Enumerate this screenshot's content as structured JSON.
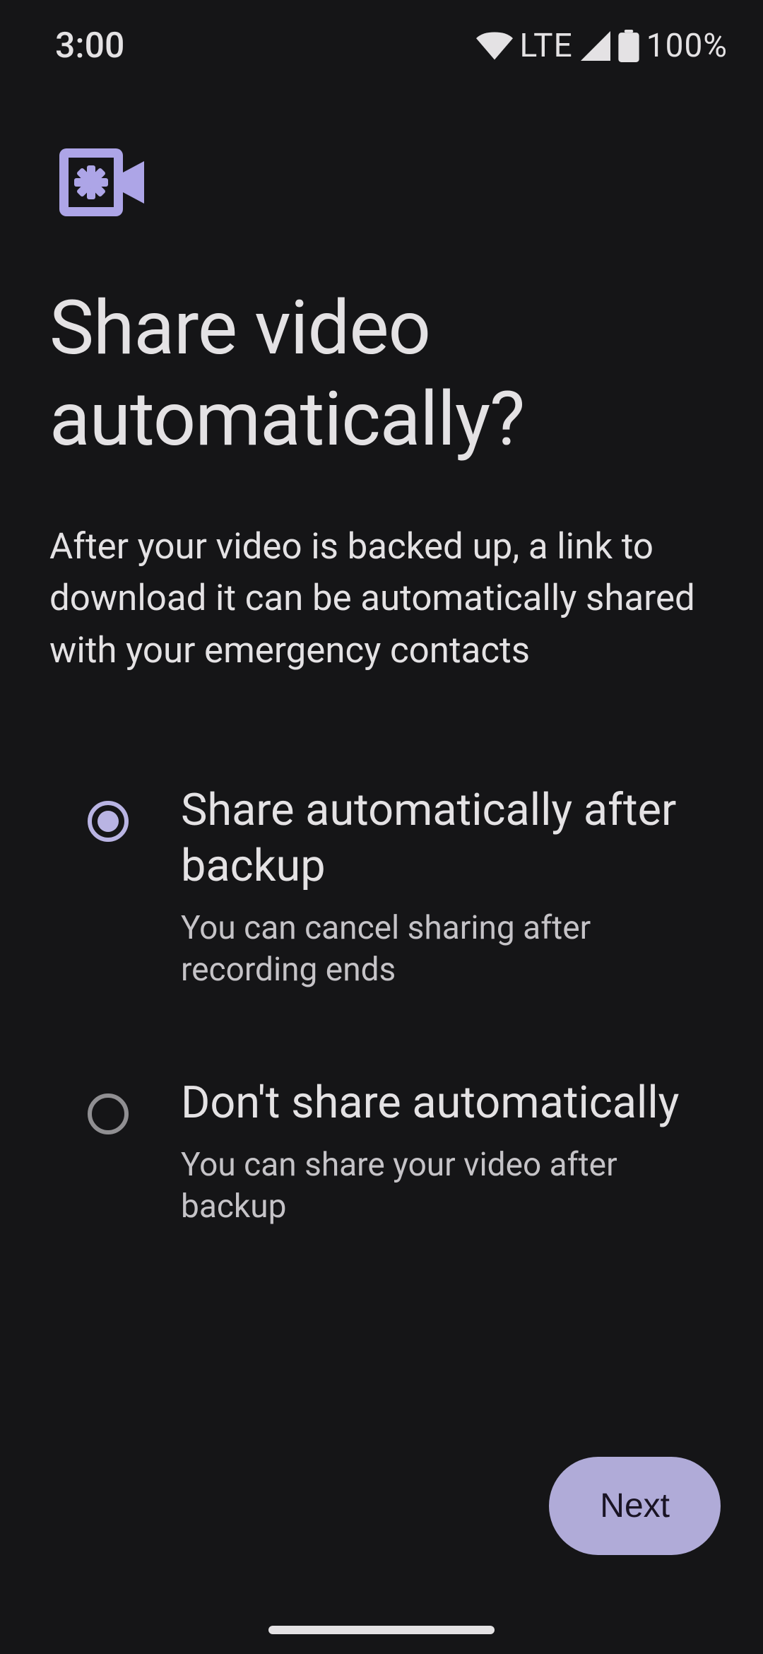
{
  "statusBar": {
    "time": "3:00",
    "network": "LTE",
    "battery": "100%"
  },
  "colors": {
    "accent": "#b0abd8",
    "iconAccent": "#ada5e7"
  },
  "page": {
    "title": "Share video automatically?",
    "description": "After your video is backed up, a link to download it can be automatically shared with your emergency contacts"
  },
  "options": [
    {
      "title": "Share automatically after backup",
      "subtitle": "You can cancel sharing after recording ends",
      "selected": true
    },
    {
      "title": "Don't share automatically",
      "subtitle": "You can share your video after backup",
      "selected": false
    }
  ],
  "footer": {
    "nextLabel": "Next"
  }
}
